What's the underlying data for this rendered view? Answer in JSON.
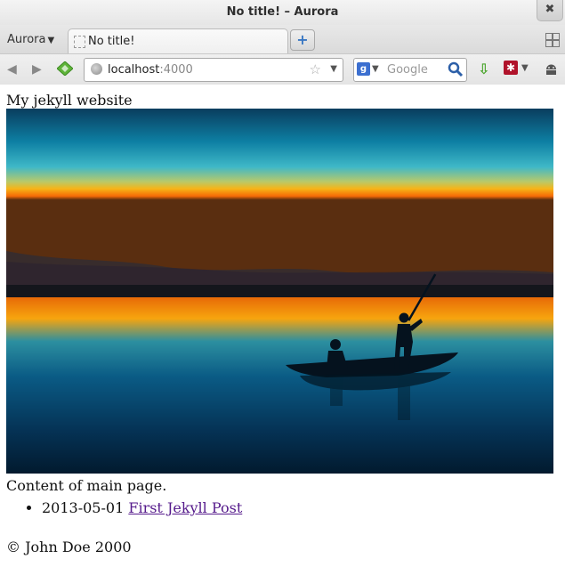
{
  "window": {
    "title": "No title! – Aurora",
    "close_symbol": "✖"
  },
  "tabbar": {
    "app_menu_label": "Aurora",
    "tab_title": "No title!",
    "new_tab_symbol": "+"
  },
  "navbar": {
    "url_host": "localhost",
    "url_port": ":4000",
    "search_engine_letter": "g",
    "search_placeholder": "Google",
    "addon_symbol": "✱"
  },
  "page": {
    "site_title": "My jekyll website",
    "content": "Content of main page.",
    "posts": [
      {
        "date": "2013-05-01",
        "title": "First Jekyll Post"
      }
    ],
    "footer": "© John Doe 2000"
  },
  "colors": {
    "visited_link": "#551a8b",
    "accent": "#3a78c3"
  }
}
